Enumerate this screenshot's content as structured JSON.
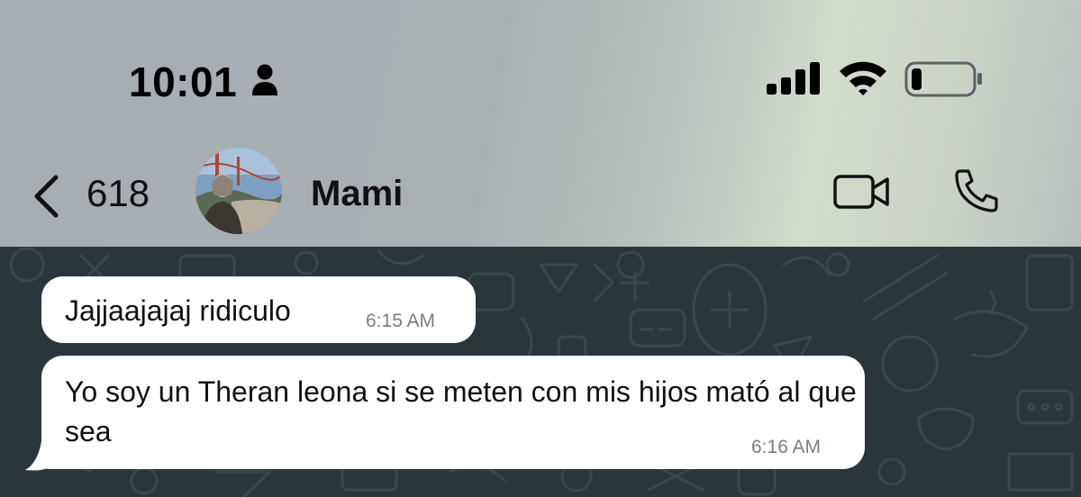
{
  "status_bar": {
    "time": "10:01",
    "icons": [
      "person-icon",
      "cellular-signal-icon",
      "wifi-icon",
      "battery-icon"
    ],
    "battery_level": 0.15
  },
  "chat_header": {
    "back_count": "618",
    "contact_name": "Mami",
    "actions": [
      "video-call-icon",
      "phone-call-icon"
    ]
  },
  "messages": [
    {
      "text": "Jajjaajajaj ridiculo",
      "time": "6:15 AM"
    },
    {
      "text": "Yo soy un Theran leona si se meten con mis hijos mató al que sea",
      "time": "6:16 AM"
    }
  ],
  "colors": {
    "chat_background": "#2b363b",
    "bubble": "#ffffff",
    "timestamp": "#7a7f82"
  }
}
